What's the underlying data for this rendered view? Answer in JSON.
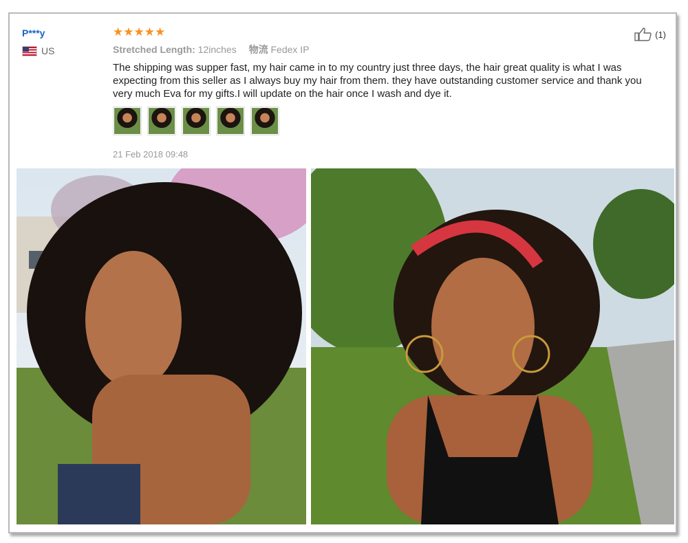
{
  "review": {
    "buyer_name": "P***y",
    "country": "US",
    "rating_stars": "★★★★★",
    "rating": 5,
    "attribute_label": "Stretched Length:",
    "attribute_value": "12inches",
    "logistics_label": "物流",
    "logistics_value": "Fedex IP",
    "text": "The shipping was supper fast, my hair came in to my country just three days, the hair great quality is what I was expecting from this seller as I always buy my hair from them. they have outstanding customer service and thank you very much Eva for my gifts.I will update on the hair once I wash and dye it.",
    "date": "21 Feb 2018 09:48",
    "helpful_count": "(1)",
    "thumbnail_count": 5
  },
  "colors": {
    "buyer_name": "#1a63c2",
    "star": "#f7931e",
    "muted_text": "#999999",
    "body_text": "#222222",
    "card_border": "#b9b9b9"
  },
  "icons": {
    "helpful": "thumbs-up-icon",
    "flag": "us-flag-icon"
  }
}
